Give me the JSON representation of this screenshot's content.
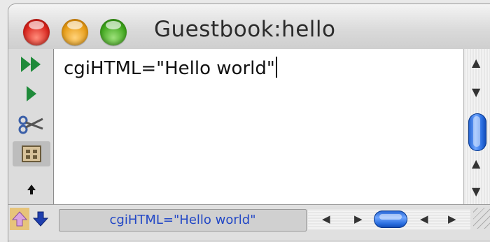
{
  "window": {
    "title": "Guestbook:hello"
  },
  "editor": {
    "code_text": "cgiHTML=\"Hello world\""
  },
  "statusbar": {
    "text": "cgiHTML=\"Hello world\""
  },
  "icons": {
    "run_all": "double-play-icon",
    "run": "play-icon",
    "cut": "scissors-icon",
    "procedure": "procedure-icon",
    "extra": "pin-icon",
    "nav_up": "up-arrow-icon",
    "nav_down": "down-arrow-icon"
  },
  "colors": {
    "status_text": "#2348c6",
    "play_green": "#1f8a3a",
    "scroll_blue": "#2a6ee0"
  }
}
